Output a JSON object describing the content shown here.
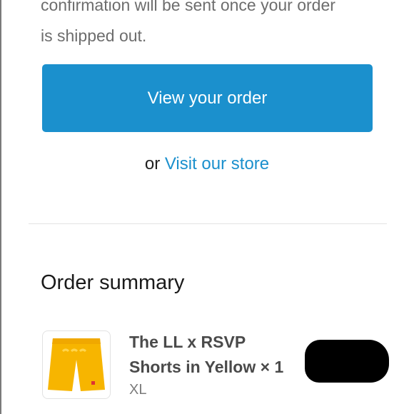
{
  "confirmation": {
    "line1": "confirmation will be sent once your order",
    "line2": "is shipped out."
  },
  "view_order_button": "View your order",
  "store_line": {
    "prefix": "or",
    "link": "Visit our store"
  },
  "order_summary": {
    "heading": "Order summary",
    "items": [
      {
        "title_line1": "The LL x RSVP",
        "title_line2": "Shorts in Yellow × 1",
        "variant": "XL",
        "price": "",
        "price_redacted": true
      }
    ]
  },
  "colors": {
    "accent": "#1b90cd",
    "button_text": "#ffffff",
    "body_text": "#6d6d6d",
    "product_yellow": "#f7b500"
  },
  "icons": {
    "product_image": "yellow-shorts-image"
  }
}
